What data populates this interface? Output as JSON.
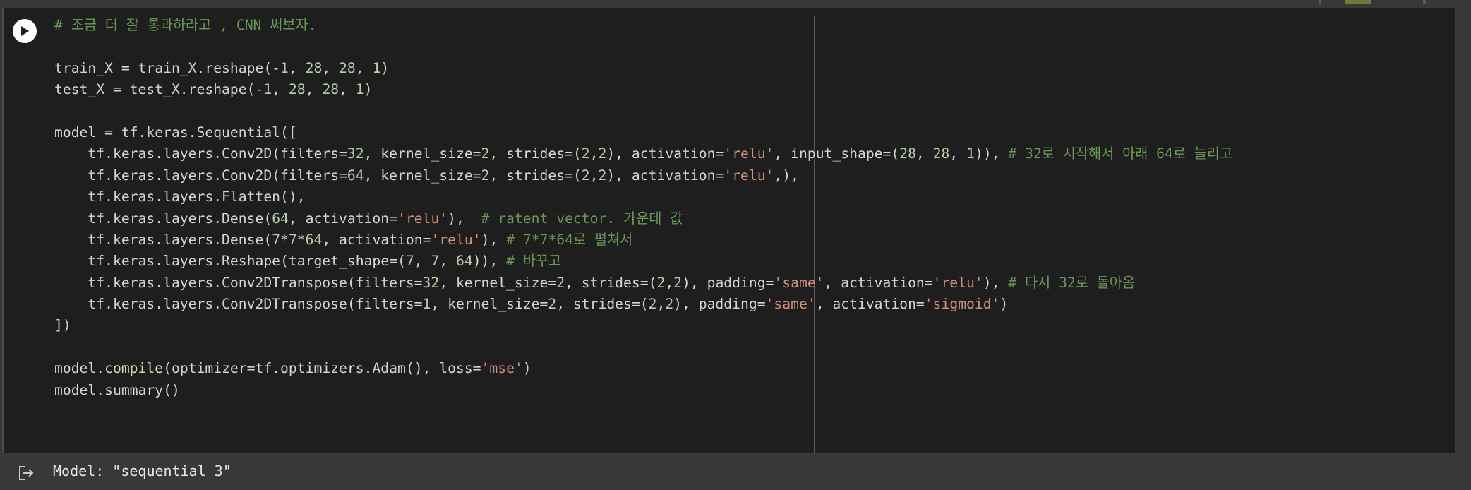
{
  "cell": {
    "run_button_label": "Run cell",
    "code_lines": [
      [
        {
          "t": "c",
          "v": "# 조금 더 잘 통과하라고 , CNN 써보자."
        }
      ],
      [],
      [
        {
          "t": "p",
          "v": "train_X = train_X.reshape(-"
        },
        {
          "t": "n",
          "v": "1"
        },
        {
          "t": "p",
          "v": ", "
        },
        {
          "t": "n",
          "v": "28"
        },
        {
          "t": "p",
          "v": ", "
        },
        {
          "t": "n",
          "v": "28"
        },
        {
          "t": "p",
          "v": ", "
        },
        {
          "t": "n",
          "v": "1"
        },
        {
          "t": "p",
          "v": ")"
        }
      ],
      [
        {
          "t": "p",
          "v": "test_X = test_X.reshape(-"
        },
        {
          "t": "n",
          "v": "1"
        },
        {
          "t": "p",
          "v": ", "
        },
        {
          "t": "n",
          "v": "28"
        },
        {
          "t": "p",
          "v": ", "
        },
        {
          "t": "n",
          "v": "28"
        },
        {
          "t": "p",
          "v": ", "
        },
        {
          "t": "n",
          "v": "1"
        },
        {
          "t": "p",
          "v": ")"
        }
      ],
      [],
      [
        {
          "t": "p",
          "v": "model = tf.keras.Sequential(["
        }
      ],
      [
        {
          "t": "p",
          "v": "    tf.keras.layers.Conv2D(filters="
        },
        {
          "t": "n",
          "v": "32"
        },
        {
          "t": "p",
          "v": ", kernel_size="
        },
        {
          "t": "n",
          "v": "2"
        },
        {
          "t": "p",
          "v": ", strides=("
        },
        {
          "t": "n",
          "v": "2"
        },
        {
          "t": "p",
          "v": ","
        },
        {
          "t": "n",
          "v": "2"
        },
        {
          "t": "p",
          "v": "), activation="
        },
        {
          "t": "s",
          "v": "'relu'"
        },
        {
          "t": "p",
          "v": ", input_shape=("
        },
        {
          "t": "n",
          "v": "28"
        },
        {
          "t": "p",
          "v": ", "
        },
        {
          "t": "n",
          "v": "28"
        },
        {
          "t": "p",
          "v": ", "
        },
        {
          "t": "n",
          "v": "1"
        },
        {
          "t": "p",
          "v": ")), "
        },
        {
          "t": "c",
          "v": "# 32로 시작해서 아래 64로 늘리고"
        }
      ],
      [
        {
          "t": "p",
          "v": "    tf.keras.layers.Conv2D(filters="
        },
        {
          "t": "n",
          "v": "64"
        },
        {
          "t": "p",
          "v": ", kernel_size="
        },
        {
          "t": "n",
          "v": "2"
        },
        {
          "t": "p",
          "v": ", strides=("
        },
        {
          "t": "n",
          "v": "2"
        },
        {
          "t": "p",
          "v": ","
        },
        {
          "t": "n",
          "v": "2"
        },
        {
          "t": "p",
          "v": "), activation="
        },
        {
          "t": "s",
          "v": "'relu'"
        },
        {
          "t": "p",
          "v": ",),"
        }
      ],
      [
        {
          "t": "p",
          "v": "    tf.keras.layers.Flatten(),"
        }
      ],
      [
        {
          "t": "p",
          "v": "    tf.keras.layers.Dense("
        },
        {
          "t": "n",
          "v": "64"
        },
        {
          "t": "p",
          "v": ", activation="
        },
        {
          "t": "s",
          "v": "'relu'"
        },
        {
          "t": "p",
          "v": "),  "
        },
        {
          "t": "c",
          "v": "# ratent vector. 가운데 값"
        }
      ],
      [
        {
          "t": "p",
          "v": "    tf.keras.layers.Dense("
        },
        {
          "t": "n",
          "v": "7"
        },
        {
          "t": "p",
          "v": "*"
        },
        {
          "t": "n",
          "v": "7"
        },
        {
          "t": "p",
          "v": "*"
        },
        {
          "t": "n",
          "v": "64"
        },
        {
          "t": "p",
          "v": ", activation="
        },
        {
          "t": "s",
          "v": "'relu'"
        },
        {
          "t": "p",
          "v": "), "
        },
        {
          "t": "c",
          "v": "# 7*7*64로 펼쳐서"
        }
      ],
      [
        {
          "t": "p",
          "v": "    tf.keras.layers.Reshape(target_shape=("
        },
        {
          "t": "n",
          "v": "7"
        },
        {
          "t": "p",
          "v": ", "
        },
        {
          "t": "n",
          "v": "7"
        },
        {
          "t": "p",
          "v": ", "
        },
        {
          "t": "n",
          "v": "64"
        },
        {
          "t": "p",
          "v": ")), "
        },
        {
          "t": "c",
          "v": "# 바꾸고"
        }
      ],
      [
        {
          "t": "p",
          "v": "    tf.keras.layers.Conv2DTranspose(filters="
        },
        {
          "t": "n",
          "v": "32"
        },
        {
          "t": "p",
          "v": ", kernel_size="
        },
        {
          "t": "n",
          "v": "2"
        },
        {
          "t": "p",
          "v": ", strides=("
        },
        {
          "t": "n",
          "v": "2"
        },
        {
          "t": "p",
          "v": ","
        },
        {
          "t": "n",
          "v": "2"
        },
        {
          "t": "p",
          "v": "), padding="
        },
        {
          "t": "s",
          "v": "'same'"
        },
        {
          "t": "p",
          "v": ", activation="
        },
        {
          "t": "s",
          "v": "'relu'"
        },
        {
          "t": "p",
          "v": "), "
        },
        {
          "t": "c",
          "v": "# 다시 32로 돌아옴"
        }
      ],
      [
        {
          "t": "p",
          "v": "    tf.keras.layers.Conv2DTranspose(filters="
        },
        {
          "t": "n",
          "v": "1"
        },
        {
          "t": "p",
          "v": ", kernel_size="
        },
        {
          "t": "n",
          "v": "2"
        },
        {
          "t": "p",
          "v": ", strides=("
        },
        {
          "t": "n",
          "v": "2"
        },
        {
          "t": "p",
          "v": ","
        },
        {
          "t": "n",
          "v": "2"
        },
        {
          "t": "p",
          "v": "), padding="
        },
        {
          "t": "s",
          "v": "'same'"
        },
        {
          "t": "p",
          "v": ", activation="
        },
        {
          "t": "s",
          "v": "'sigmoid'"
        },
        {
          "t": "p",
          "v": ")"
        }
      ],
      [
        {
          "t": "p",
          "v": "])"
        }
      ],
      [],
      [
        {
          "t": "p",
          "v": "model."
        },
        {
          "t": "f",
          "v": "compile"
        },
        {
          "t": "p",
          "v": "(optimizer=tf.optimizers.Adam(), loss="
        },
        {
          "t": "s",
          "v": "'mse'"
        },
        {
          "t": "p",
          "v": ")"
        }
      ],
      [
        {
          "t": "p",
          "v": "model.summary()"
        }
      ]
    ]
  },
  "output": {
    "text": "Model: \"sequential_3\""
  },
  "colors": {
    "page_background": "#383838",
    "cell_background": "#1e1e1e",
    "default_text": "#d4d4d4",
    "comment": "#6a9955",
    "string": "#ce9178",
    "number": "#b5cea8",
    "function": "#dcdcaa",
    "output_text": "#e8e8e8"
  }
}
